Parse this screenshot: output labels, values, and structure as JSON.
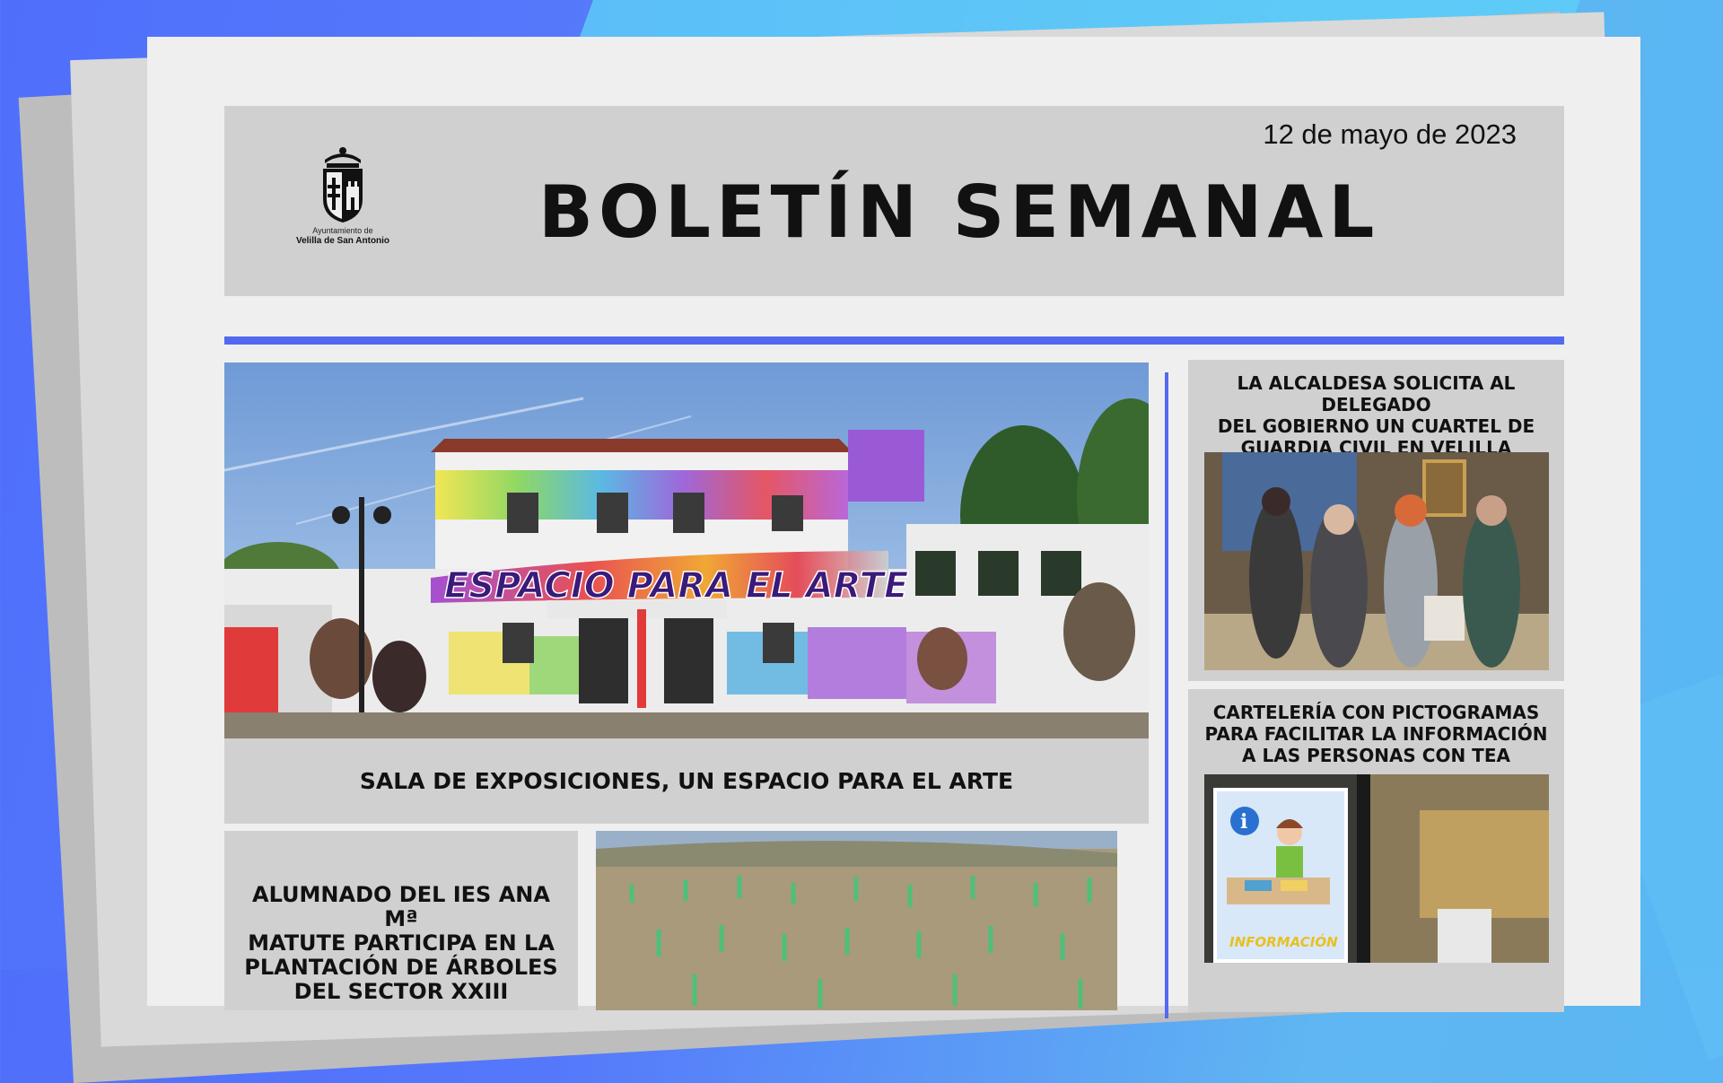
{
  "header": {
    "logo_line1": "Ayuntamiento de",
    "logo_line2": "Velilla de San Antonio",
    "date": "12 de mayo de 2023",
    "title": "BOLETÍN SEMANAL"
  },
  "main_story": {
    "caption": "SALA DE EXPOSICIONES, UN ESPACIO PARA EL ARTE",
    "mural_text": "ESPACIO PARA EL ARTE",
    "photo_label": "building-mural-photo"
  },
  "stories": [
    {
      "title": "ALUMNADO DEL IES ANA Mª MATUTE PARTICIPA EN LA PLANTACIÓN DE ÁRBOLES DEL SECTOR XXIII",
      "title_lines": [
        "ALUMNADO DEL IES ANA Mª",
        "MATUTE PARTICIPA EN LA",
        "PLANTACIÓN DE ÁRBOLES",
        "DEL SECTOR XXIII"
      ],
      "photo_label": "tree-planting-photo"
    },
    {
      "title_lines": [
        "LA ALCALDESA SOLICITA AL DELEGADO",
        "DEL GOBIERNO UN CUARTEL DE",
        "GUARDIA CIVIL EN VELILLA"
      ],
      "photo_label": "meeting-photo"
    },
    {
      "title_lines": [
        "CARTELERÍA CON PICTOGRAMAS",
        "PARA FACILITAR LA INFORMACIÓN",
        "A LAS PERSONAS CON TEA"
      ],
      "sign_text": "INFORMACIÓN",
      "photo_label": "pictogram-sign-photo"
    }
  ],
  "colors": {
    "accent_rule": "#5369f0",
    "header_bg": "#d0d0d0",
    "paper": "#efefef"
  }
}
